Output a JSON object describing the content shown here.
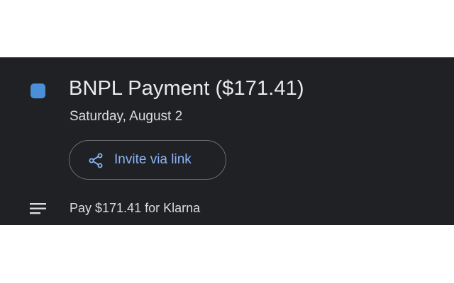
{
  "event": {
    "title": "BNPL Payment ($171.41)",
    "date": "Saturday, August 2",
    "color": "#4a8fd8",
    "invite_label": "Invite via link",
    "invite_icon": "share-icon",
    "description_icon": "notes-icon",
    "description": "Pay $171.41 for Klarna"
  },
  "colors": {
    "panel_background": "#202124",
    "link": "#8ab4f8",
    "text": "#e8eaed"
  }
}
